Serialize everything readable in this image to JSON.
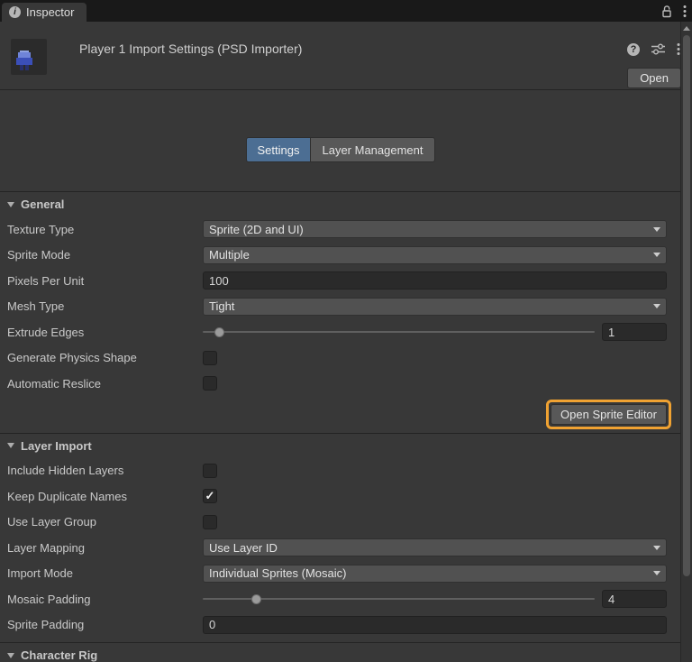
{
  "titlebar": {
    "tab_label": "Inspector"
  },
  "icons": {
    "info_glyph": "i",
    "help_glyph": "?"
  },
  "header": {
    "title": "Player 1 Import Settings (PSD Importer)",
    "open_button_label": "Open"
  },
  "tabs": {
    "settings_label": "Settings",
    "layer_management_label": "Layer Management",
    "selected": "Settings"
  },
  "general": {
    "title": "General",
    "texture_type": {
      "label": "Texture Type",
      "value": "Sprite (2D and UI)"
    },
    "sprite_mode": {
      "label": "Sprite Mode",
      "value": "Multiple"
    },
    "pixels_per_unit": {
      "label": "Pixels Per Unit",
      "value": "100"
    },
    "mesh_type": {
      "label": "Mesh Type",
      "value": "Tight"
    },
    "extrude_edges": {
      "label": "Extrude Edges",
      "value": "1"
    },
    "generate_physics_shape": {
      "label": "Generate Physics Shape",
      "checked": false
    },
    "automatic_reslice": {
      "label": "Automatic Reslice",
      "checked": false
    },
    "open_sprite_editor_label": "Open Sprite Editor"
  },
  "layer_import": {
    "title": "Layer Import",
    "include_hidden_layers": {
      "label": "Include Hidden Layers",
      "checked": false
    },
    "keep_duplicate_names": {
      "label": "Keep Duplicate Names",
      "checked": true,
      "checkmark": "✓"
    },
    "use_layer_group": {
      "label": "Use Layer Group",
      "checked": false
    },
    "layer_mapping": {
      "label": "Layer Mapping",
      "value": "Use Layer ID"
    },
    "import_mode": {
      "label": "Import Mode",
      "value": "Individual Sprites (Mosaic)"
    },
    "mosaic_padding": {
      "label": "Mosaic Padding",
      "value": "4"
    },
    "sprite_padding": {
      "label": "Sprite Padding",
      "value": "0"
    }
  },
  "character_rig": {
    "title": "Character Rig"
  },
  "colors": {
    "background": "#383838",
    "selected_tab_blue": "#4C6E93",
    "highlight_orange": "#F0A232",
    "field_dark": "#2A2A2A",
    "dropdown_gray": "#515151"
  }
}
